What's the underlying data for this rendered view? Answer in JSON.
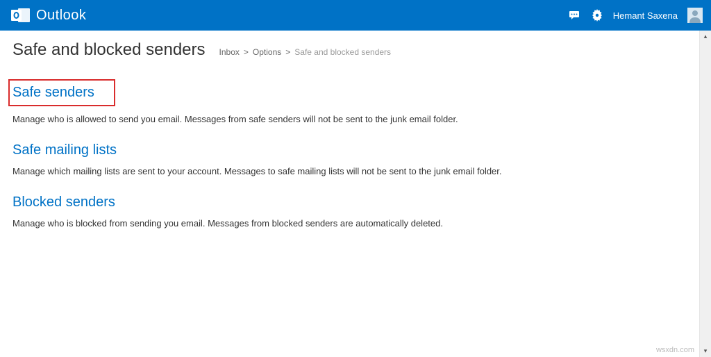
{
  "header": {
    "app_name": "Outlook",
    "user_name": "Hemant Saxena"
  },
  "page": {
    "title": "Safe and blocked senders"
  },
  "breadcrumb": {
    "items": [
      {
        "label": "Inbox"
      },
      {
        "label": "Options"
      }
    ],
    "current": "Safe and blocked senders",
    "sep": ">"
  },
  "sections": [
    {
      "title": "Safe senders",
      "description": "Manage who is allowed to send you email. Messages from safe senders will not be sent to the junk email folder.",
      "highlighted": true
    },
    {
      "title": "Safe mailing lists",
      "description": "Manage which mailing lists are sent to your account. Messages to safe mailing lists will not be sent to the junk email folder.",
      "highlighted": false
    },
    {
      "title": "Blocked senders",
      "description": "Manage who is blocked from sending you email. Messages from blocked senders are automatically deleted.",
      "highlighted": false
    }
  ],
  "watermark": "wsxdn.com",
  "colors": {
    "brand": "#0072c6",
    "link": "#0072c6",
    "highlight_border": "#d92c2c"
  }
}
